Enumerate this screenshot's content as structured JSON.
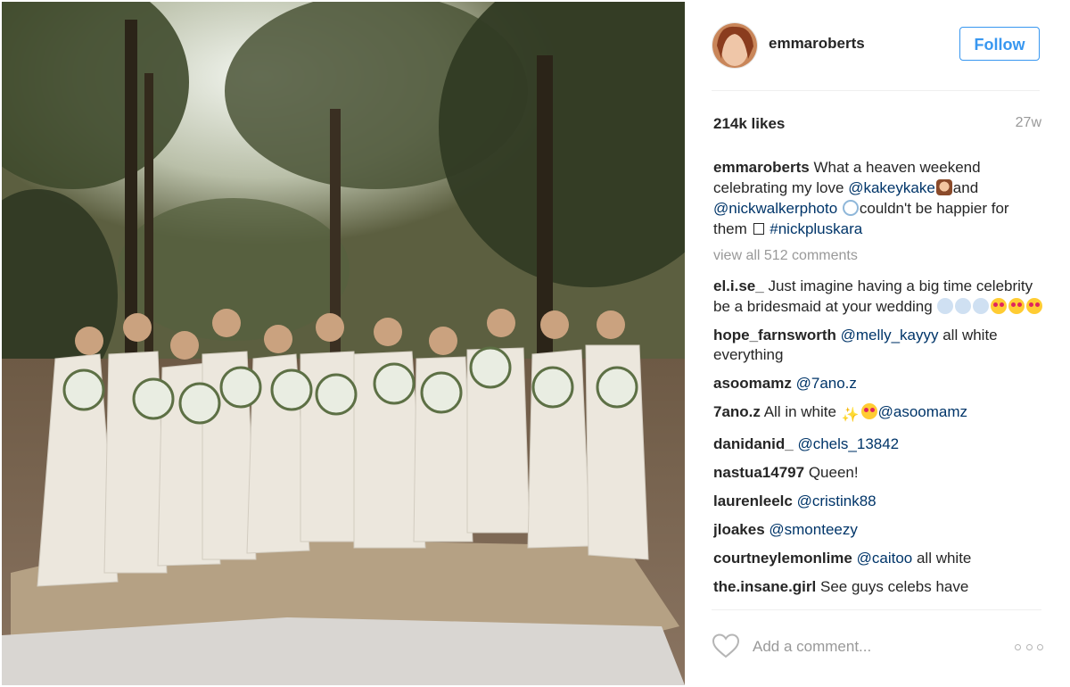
{
  "post": {
    "username": "emmaroberts",
    "follow_label": "Follow",
    "likes": "214k likes",
    "age": "27w",
    "caption": {
      "text1": "What a heaven weekend celebrating my love",
      "mention1": "@kakeykake",
      "text2": "and",
      "mention2": "@nickwalkerphoto",
      "text3": "couldn't be happier for them",
      "hashtag": "#nickpluskara"
    },
    "view_all": "view all 512 comments",
    "comment_placeholder": "Add a comment...",
    "photo_alt": "bridesmaids-photo"
  },
  "comments": [
    {
      "user": "el.i.se_",
      "text": "Just imagine having a big time celebrity be a bridesmaid at your wedding",
      "mention": ""
    },
    {
      "user": "hope_farnsworth",
      "text": "all white everything",
      "mention": "@melly_kayyy"
    },
    {
      "user": "asoomamz",
      "text": "",
      "mention": "@7ano.z"
    },
    {
      "user": "7ano.z",
      "text": "All in white",
      "mention": "@asoomamz"
    },
    {
      "user": "danidanid_",
      "text": "",
      "mention": "@chels_13842"
    },
    {
      "user": "nastua14797",
      "text": "Queen!",
      "mention": ""
    },
    {
      "user": "laurenleelc",
      "text": "",
      "mention": "@cristink88"
    },
    {
      "user": "jloakes",
      "text": "",
      "mention": "@smonteezy"
    },
    {
      "user": "courtneylemonlime",
      "text": "all white",
      "mention": "@caitoo"
    },
    {
      "user": "the.insane.girl",
      "text": "See guys celebs have",
      "mention": ""
    }
  ],
  "icons": {
    "like": "heart-outline-icon",
    "more": "more-options-icon"
  },
  "colors": {
    "link": "#003569",
    "follow": "#3897f0",
    "muted": "#999999",
    "text": "#262626"
  }
}
